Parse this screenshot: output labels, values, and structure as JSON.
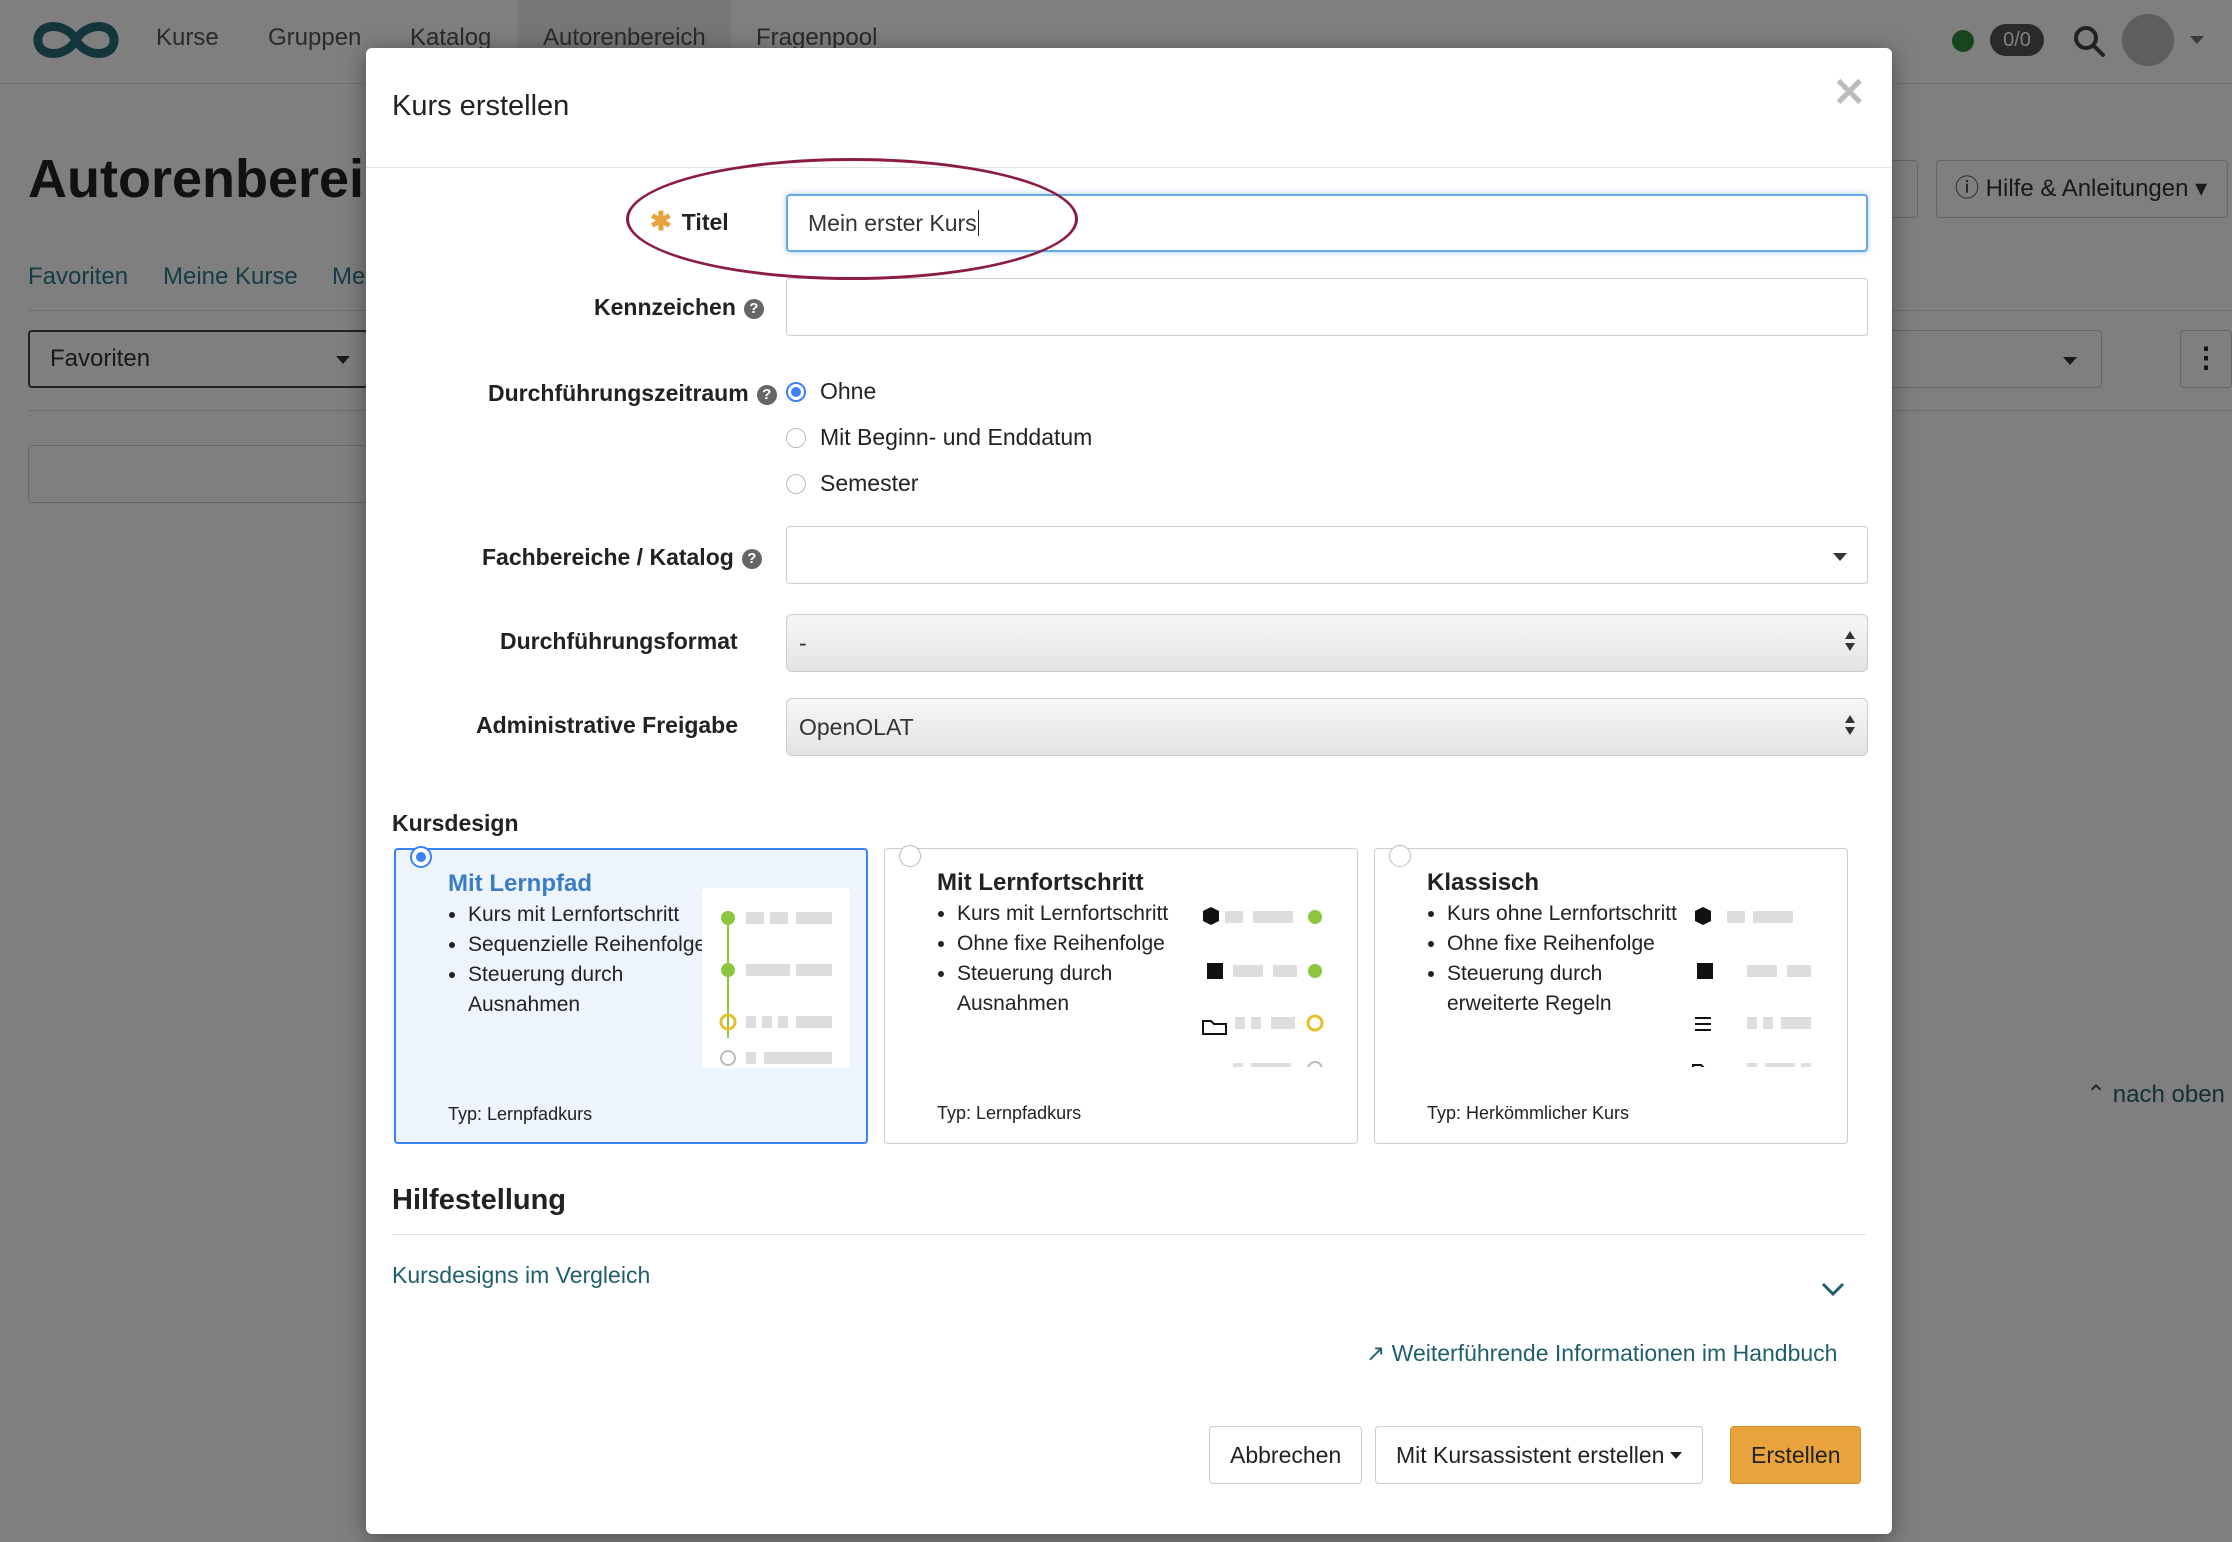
{
  "topnav": {
    "items": [
      "Kurse",
      "Gruppen",
      "Katalog",
      "Autorenbereich",
      "Fragenpool"
    ],
    "badge": "0/0"
  },
  "background": {
    "title": "Autorenbereich",
    "tabs": [
      "Favoriten",
      "Meine Kurse",
      "Me"
    ],
    "filter_select": "Favoriten",
    "help_button": "Hilfe & Anleitungen",
    "to_top": "nach oben"
  },
  "modal": {
    "title": "Kurs erstellen",
    "fields": {
      "titel_label": "Titel",
      "titel_value": "Mein erster Kurs",
      "kennzeichen_label": "Kennzeichen",
      "kennzeichen_value": "",
      "zeitraum_label": "Durchführungszeitraum",
      "zeitraum_options": [
        "Ohne",
        "Mit Beginn- und Enddatum",
        "Semester"
      ],
      "zeitraum_selected": "Ohne",
      "fachbereiche_label": "Fachbereiche / Katalog",
      "fachbereiche_value": "",
      "format_label": "Durchführungsformat",
      "format_value": "-",
      "freigabe_label": "Administrative Freigabe",
      "freigabe_value": "OpenOLAT"
    },
    "kursdesign": {
      "heading": "Kursdesign",
      "cards": [
        {
          "title": "Mit Lernpfad",
          "selected": true,
          "bullets": [
            "Kurs mit Lernfortschritt",
            "Sequenzielle Reihenfolge",
            "Steuerung durch Ausnahmen"
          ],
          "type": "Typ: Lernpfadkurs"
        },
        {
          "title": "Mit Lernfortschritt",
          "selected": false,
          "bullets": [
            "Kurs mit Lernfortschritt",
            "Ohne fixe Reihenfolge",
            "Steuerung durch Ausnahmen"
          ],
          "type": "Typ: Lernpfadkurs"
        },
        {
          "title": "Klassisch",
          "selected": false,
          "bullets": [
            "Kurs ohne Lernfortschritt",
            "Ohne fixe Reihenfolge",
            "Steuerung durch erweiterte Regeln"
          ],
          "type": "Typ: Herkömmlicher Kurs"
        }
      ]
    },
    "help": {
      "heading": "Hilfestellung",
      "compare_link": "Kursdesigns im Vergleich",
      "manual_link": "Weiterführende Informationen im Handbuch"
    },
    "buttons": {
      "cancel": "Abbrechen",
      "wizard": "Mit Kursassistent erstellen",
      "create": "Erstellen"
    }
  },
  "colors": {
    "accent": "#3b82f6",
    "primary_button": "#e8a33d",
    "link": "#1f5f6d",
    "annotation": "#8b1d3e"
  }
}
